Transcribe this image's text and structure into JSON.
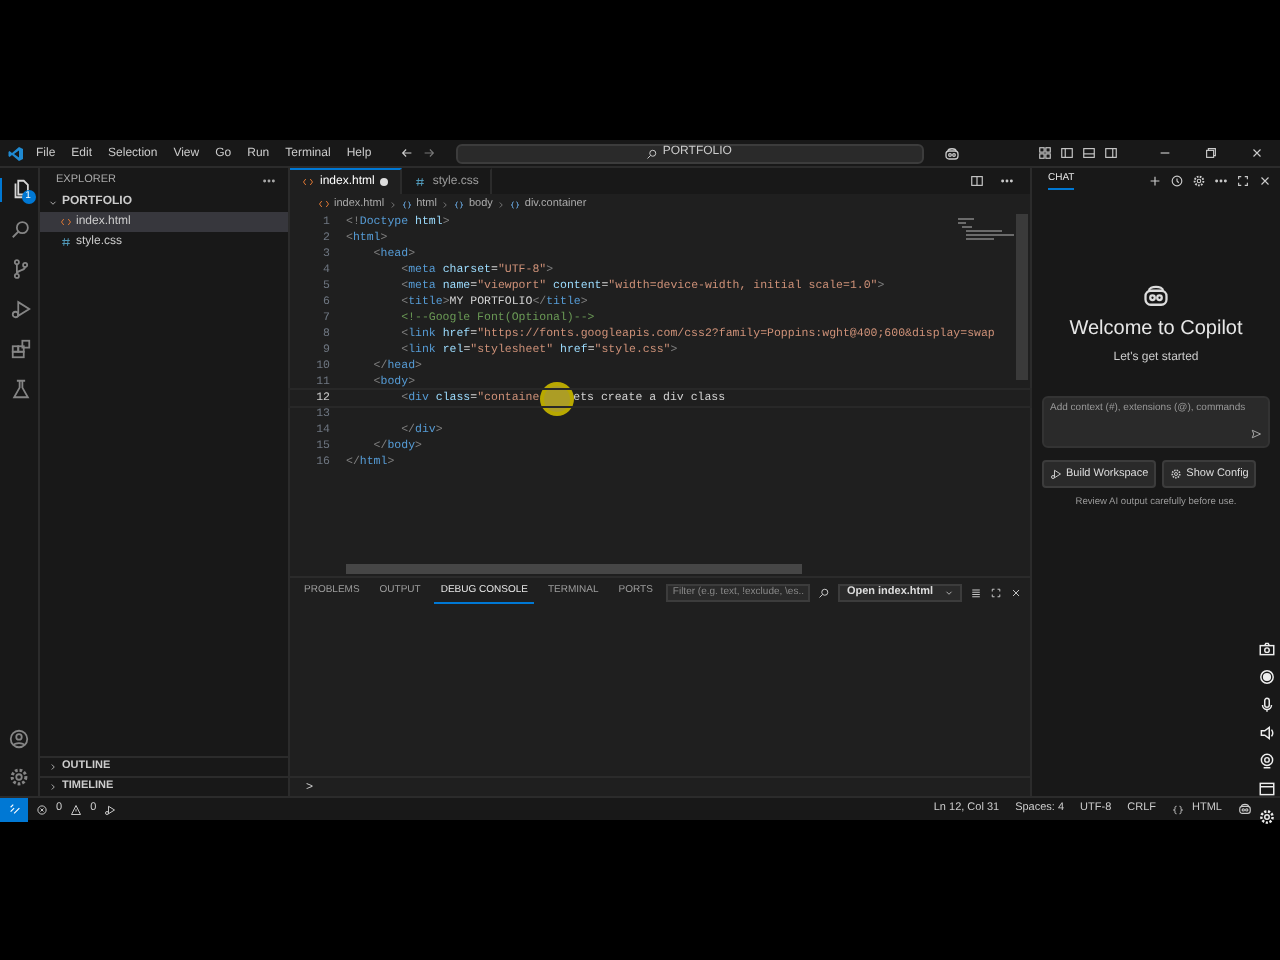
{
  "title_bar": {
    "menu": [
      "File",
      "Edit",
      "Selection",
      "View",
      "Go",
      "Run",
      "Terminal",
      "Help"
    ],
    "search": "PORTFOLIO"
  },
  "activity_bar": [
    {
      "kind": "explorer",
      "selected": true,
      "badge": "1"
    },
    {
      "kind": "search",
      "selected": false
    },
    {
      "kind": "source-control",
      "selected": false
    },
    {
      "kind": "run",
      "selected": false
    },
    {
      "kind": "extensions",
      "selected": false
    },
    {
      "kind": "testing",
      "selected": false
    }
  ],
  "sidebar": {
    "title": "EXPLORER",
    "folder": "PORTFOLIO",
    "expanded": true,
    "files": [
      {
        "name": "index.html",
        "kind": "html",
        "selected": true
      },
      {
        "name": "style.css",
        "kind": "css",
        "selected": false
      }
    ],
    "sections": [
      "OUTLINE",
      "TIMELINE"
    ]
  },
  "editor": {
    "tabs": [
      {
        "label": "index.html",
        "kind": "html",
        "selected": true,
        "modified": true
      },
      {
        "label": "style.css",
        "kind": "css",
        "selected": false,
        "modified": false
      }
    ],
    "breadcrumb": [
      "index.html",
      "html",
      "body",
      "div.container"
    ],
    "lines": [
      {
        "number": "1",
        "current": false,
        "tokens": [
          {
            "kind": "punct",
            "text": "<!"
          },
          {
            "kind": "tag",
            "text": "Doctype"
          },
          {
            "kind": "attr",
            "text": " html"
          },
          {
            "kind": "punct",
            "text": ">"
          }
        ]
      },
      {
        "number": "2",
        "current": false,
        "tokens": [
          {
            "kind": "punct",
            "text": "<"
          },
          {
            "kind": "tag",
            "text": "html"
          },
          {
            "kind": "punct",
            "text": ">"
          }
        ]
      },
      {
        "number": "3",
        "current": false,
        "tokens": [
          {
            "kind": "punct",
            "text": "    <"
          },
          {
            "kind": "tag",
            "text": "head"
          },
          {
            "kind": "punct",
            "text": ">"
          }
        ]
      },
      {
        "number": "4",
        "current": false,
        "tokens": [
          {
            "kind": "punct",
            "text": "        <"
          },
          {
            "kind": "tag",
            "text": "meta"
          },
          {
            "kind": "attr",
            "text": " charset"
          },
          {
            "kind": "text",
            "text": "="
          },
          {
            "kind": "string",
            "text": "\"UTF-8\""
          },
          {
            "kind": "punct",
            "text": ">"
          }
        ]
      },
      {
        "number": "5",
        "current": false,
        "tokens": [
          {
            "kind": "punct",
            "text": "        <"
          },
          {
            "kind": "tag",
            "text": "meta"
          },
          {
            "kind": "attr",
            "text": " name"
          },
          {
            "kind": "text",
            "text": "="
          },
          {
            "kind": "string",
            "text": "\"viewport\""
          },
          {
            "kind": "attr",
            "text": " content"
          },
          {
            "kind": "text",
            "text": "="
          },
          {
            "kind": "string",
            "text": "\"width=device-width, initial scale=1.0\""
          },
          {
            "kind": "punct",
            "text": ">"
          }
        ]
      },
      {
        "number": "6",
        "current": false,
        "tokens": [
          {
            "kind": "punct",
            "text": "        <"
          },
          {
            "kind": "tag",
            "text": "title"
          },
          {
            "kind": "punct",
            "text": ">"
          },
          {
            "kind": "text",
            "text": "MY PORTFOLIO"
          },
          {
            "kind": "punct",
            "text": "</"
          },
          {
            "kind": "tag",
            "text": "title"
          },
          {
            "kind": "punct",
            "text": ">"
          }
        ]
      },
      {
        "number": "7",
        "current": false,
        "tokens": [
          {
            "kind": "comment",
            "text": "        <!--Google Font(Optional)-->"
          }
        ]
      },
      {
        "number": "8",
        "current": false,
        "tokens": [
          {
            "kind": "punct",
            "text": "        <"
          },
          {
            "kind": "tag",
            "text": "link"
          },
          {
            "kind": "attr",
            "text": " href"
          },
          {
            "kind": "text",
            "text": "="
          },
          {
            "kind": "string",
            "text": "\"https://fonts.googleapis.com/css2?family=Poppins:wght@400;600&display=swap"
          }
        ]
      },
      {
        "number": "9",
        "current": false,
        "tokens": [
          {
            "kind": "punct",
            "text": "        <"
          },
          {
            "kind": "tag",
            "text": "link"
          },
          {
            "kind": "attr",
            "text": " rel"
          },
          {
            "kind": "text",
            "text": "="
          },
          {
            "kind": "string",
            "text": "\"stylesheet\""
          },
          {
            "kind": "attr",
            "text": " href"
          },
          {
            "kind": "text",
            "text": "="
          },
          {
            "kind": "string",
            "text": "\"style.css\""
          },
          {
            "kind": "punct",
            "text": ">"
          }
        ]
      },
      {
        "number": "10",
        "current": false,
        "tokens": [
          {
            "kind": "punct",
            "text": "    </"
          },
          {
            "kind": "tag",
            "text": "head"
          },
          {
            "kind": "punct",
            "text": ">"
          }
        ]
      },
      {
        "number": "11",
        "current": false,
        "tokens": [
          {
            "kind": "punct",
            "text": "    <"
          },
          {
            "kind": "tag",
            "text": "body"
          },
          {
            "kind": "punct",
            "text": ">"
          }
        ]
      },
      {
        "number": "12",
        "current": true,
        "tokens": [
          {
            "kind": "punct",
            "text": "        <"
          },
          {
            "kind": "tag",
            "text": "div"
          },
          {
            "kind": "attr",
            "text": " class"
          },
          {
            "kind": "text",
            "text": "="
          },
          {
            "kind": "string",
            "text": "\"containe"
          },
          {
            "kind": "highlight"
          },
          {
            "kind": "text",
            "text": "ets create a div class"
          }
        ]
      },
      {
        "number": "13",
        "current": false
      },
      {
        "number": "14",
        "current": false,
        "tokens": [
          {
            "kind": "punct",
            "text": "        </"
          },
          {
            "kind": "tag",
            "text": "div"
          },
          {
            "kind": "punct",
            "text": ">"
          }
        ]
      },
      {
        "number": "15",
        "current": false,
        "tokens": [
          {
            "kind": "punct",
            "text": "    </"
          },
          {
            "kind": "tag",
            "text": "body"
          },
          {
            "kind": "punct",
            "text": ">"
          }
        ]
      },
      {
        "number": "16",
        "current": false,
        "tokens": [
          {
            "kind": "punct",
            "text": "</"
          },
          {
            "kind": "tag",
            "text": "html"
          },
          {
            "kind": "punct",
            "text": ">"
          }
        ]
      }
    ]
  },
  "panel": {
    "tabs": [
      {
        "label": "PROBLEMS",
        "selected": false
      },
      {
        "label": "OUTPUT",
        "selected": false
      },
      {
        "label": "DEBUG CONSOLE",
        "selected": true
      },
      {
        "label": "TERMINAL",
        "selected": false
      },
      {
        "label": "PORTS",
        "selected": false
      }
    ],
    "filter_placeholder": "Filter (e.g. text, !exclude, \\es...",
    "dropdown": "Open index.html",
    "prompt": ">"
  },
  "chat": {
    "title": "CHAT",
    "heading": "Welcome to Copilot",
    "subheading": "Let's get started",
    "input_placeholder": "Add context (#), extensions (@), commands",
    "buttons": [
      {
        "label": "Build Workspace",
        "kind": "build"
      },
      {
        "label": "Show Config",
        "kind": "config"
      }
    ],
    "note": "Review AI output carefully before use."
  },
  "status_bar": {
    "errors": "0",
    "warnings": "0",
    "position": "Ln 12, Col 31",
    "indent": "Spaces: 4",
    "encoding": "UTF-8",
    "eol": "CRLF",
    "language": "HTML"
  }
}
